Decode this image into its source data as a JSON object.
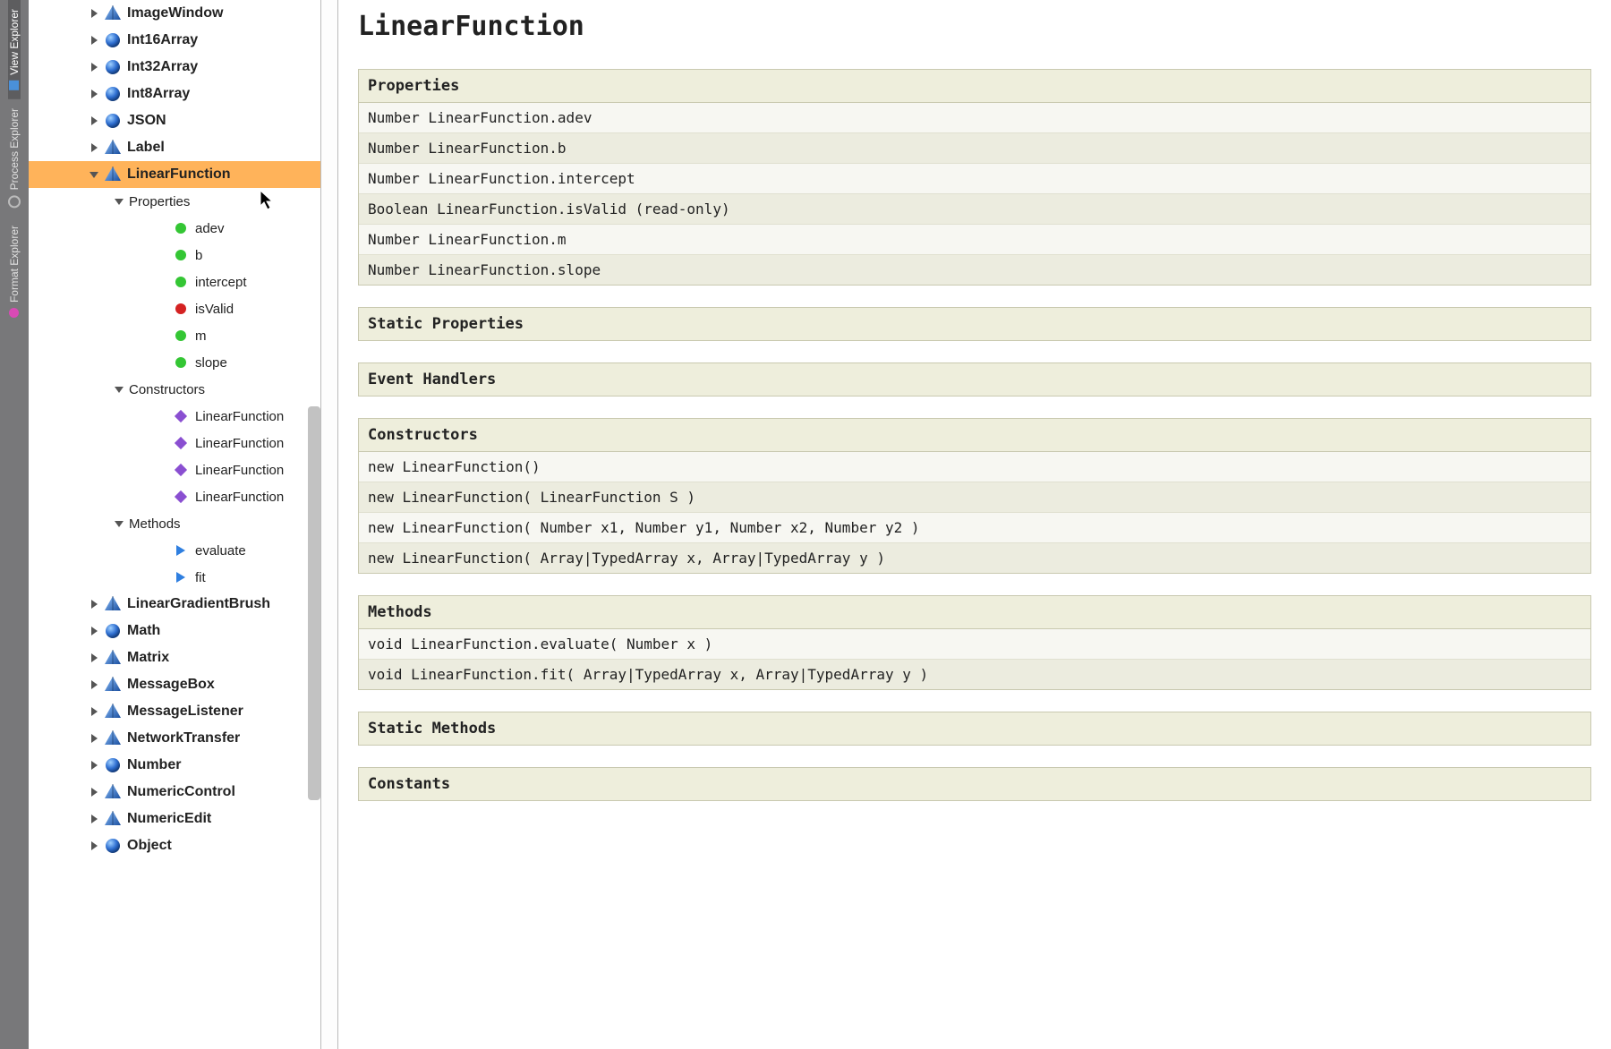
{
  "sideTabs": {
    "view": "View Explorer",
    "process": "Process Explorer",
    "format": "Format Explorer"
  },
  "tree": {
    "classes": [
      {
        "name": "ImageWindow",
        "variant": "pyramid"
      },
      {
        "name": "Int16Array",
        "variant": "sphere"
      },
      {
        "name": "Int32Array",
        "variant": "sphere"
      },
      {
        "name": "Int8Array",
        "variant": "sphere"
      },
      {
        "name": "JSON",
        "variant": "sphere"
      },
      {
        "name": "Label",
        "variant": "pyramid"
      },
      {
        "name": "LinearFunction",
        "variant": "pyramid",
        "selected": true
      },
      {
        "name": "LinearGradientBrush",
        "variant": "pyramid"
      },
      {
        "name": "Math",
        "variant": "sphere"
      },
      {
        "name": "Matrix",
        "variant": "pyramid"
      },
      {
        "name": "MessageBox",
        "variant": "pyramid"
      },
      {
        "name": "MessageListener",
        "variant": "pyramid"
      },
      {
        "name": "NetworkTransfer",
        "variant": "pyramid"
      },
      {
        "name": "Number",
        "variant": "sphere"
      },
      {
        "name": "NumericControl",
        "variant": "pyramid"
      },
      {
        "name": "NumericEdit",
        "variant": "pyramid"
      },
      {
        "name": "Object",
        "variant": "sphere"
      }
    ],
    "selected": {
      "groups": {
        "properties": "Properties",
        "constructors": "Constructors",
        "methods": "Methods"
      },
      "properties": [
        {
          "name": "adev",
          "kind": "rw"
        },
        {
          "name": "b",
          "kind": "rw"
        },
        {
          "name": "intercept",
          "kind": "rw"
        },
        {
          "name": "isValid",
          "kind": "ro"
        },
        {
          "name": "m",
          "kind": "rw"
        },
        {
          "name": "slope",
          "kind": "rw"
        }
      ],
      "constructors": [
        {
          "name": "LinearFunction"
        },
        {
          "name": "LinearFunction"
        },
        {
          "name": "LinearFunction"
        },
        {
          "name": "LinearFunction"
        }
      ],
      "methods": [
        {
          "name": "evaluate"
        },
        {
          "name": "fit"
        }
      ]
    }
  },
  "doc": {
    "title": "LinearFunction",
    "sections": {
      "properties": "Properties",
      "static_properties": "Static Properties",
      "event_handlers": "Event Handlers",
      "constructors": "Constructors",
      "methods": "Methods",
      "static_methods": "Static Methods",
      "constants": "Constants"
    },
    "properties": [
      "Number LinearFunction.adev",
      "Number LinearFunction.b",
      "Number LinearFunction.intercept",
      "Boolean LinearFunction.isValid (read-only)",
      "Number LinearFunction.m",
      "Number LinearFunction.slope"
    ],
    "constructors": [
      "new LinearFunction()",
      "new LinearFunction( LinearFunction S )",
      "new LinearFunction( Number x1, Number y1, Number x2, Number y2 )",
      "new LinearFunction( Array|TypedArray x, Array|TypedArray y )"
    ],
    "methods": [
      "void LinearFunction.evaluate( Number x )",
      "void LinearFunction.fit( Array|TypedArray x, Array|TypedArray y )"
    ]
  }
}
